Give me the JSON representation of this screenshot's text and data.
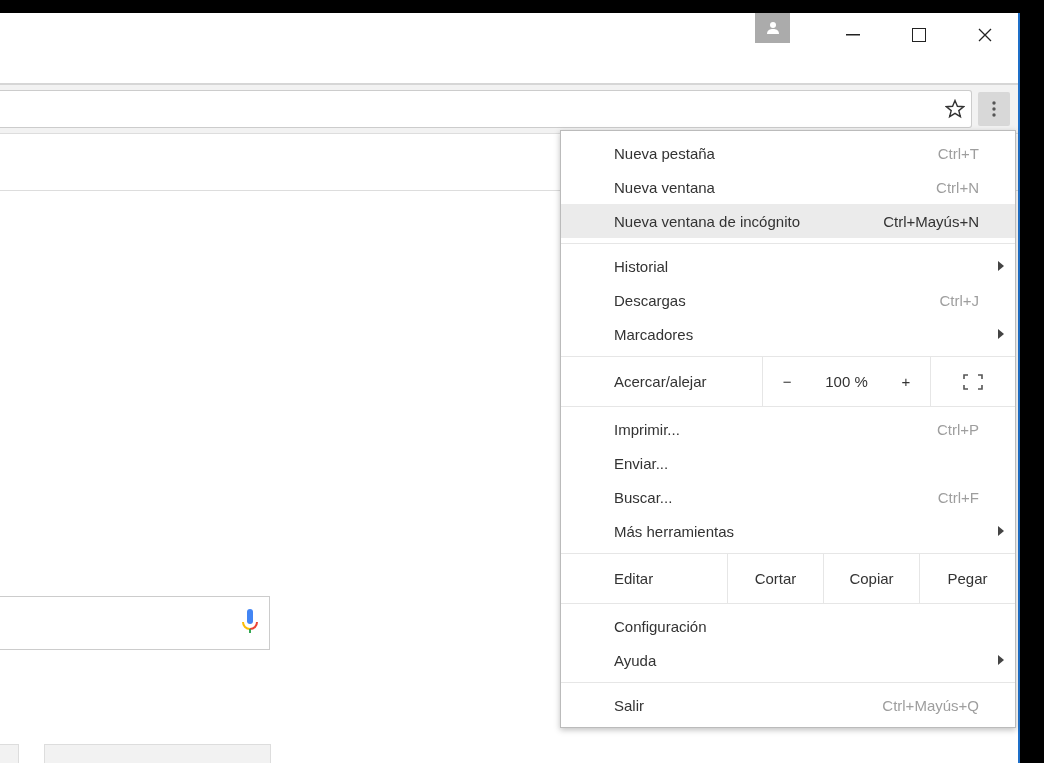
{
  "menu": {
    "sections": [
      {
        "kind": "items",
        "items": [
          {
            "label": "Nueva pestaña",
            "shortcut": "Ctrl+T",
            "submenu": false,
            "highlighted": false
          },
          {
            "label": "Nueva ventana",
            "shortcut": "Ctrl+N",
            "submenu": false,
            "highlighted": false
          },
          {
            "label": "Nueva ventana de incógnito",
            "shortcut": "Ctrl+Mayús+N",
            "submenu": false,
            "highlighted": true
          }
        ]
      },
      {
        "kind": "items",
        "items": [
          {
            "label": "Historial",
            "submenu": true,
            "highlighted": false
          },
          {
            "label": "Descargas",
            "shortcut": "Ctrl+J",
            "submenu": false,
            "highlighted": false
          },
          {
            "label": "Marcadores",
            "submenu": true,
            "highlighted": false
          }
        ]
      },
      {
        "kind": "zoom",
        "label": "Acercar/alejar",
        "minus": "−",
        "value": "100 %",
        "plus": "+"
      },
      {
        "kind": "items",
        "items": [
          {
            "label": "Imprimir...",
            "shortcut": "Ctrl+P",
            "submenu": false,
            "highlighted": false
          },
          {
            "label": "Enviar...",
            "submenu": false,
            "highlighted": false
          },
          {
            "label": "Buscar...",
            "shortcut": "Ctrl+F",
            "submenu": false,
            "highlighted": false
          },
          {
            "label": "Más herramientas",
            "submenu": true,
            "highlighted": false
          }
        ]
      },
      {
        "kind": "edit",
        "label": "Editar",
        "buttons": [
          "Cortar",
          "Copiar",
          "Pegar"
        ]
      },
      {
        "kind": "items",
        "items": [
          {
            "label": "Configuración",
            "submenu": false,
            "highlighted": false
          },
          {
            "label": "Ayuda",
            "submenu": true,
            "highlighted": false
          }
        ]
      },
      {
        "kind": "items",
        "items": [
          {
            "label": "Salir",
            "shortcut": "Ctrl+Mayús+Q",
            "submenu": false,
            "highlighted": false
          }
        ]
      }
    ]
  }
}
